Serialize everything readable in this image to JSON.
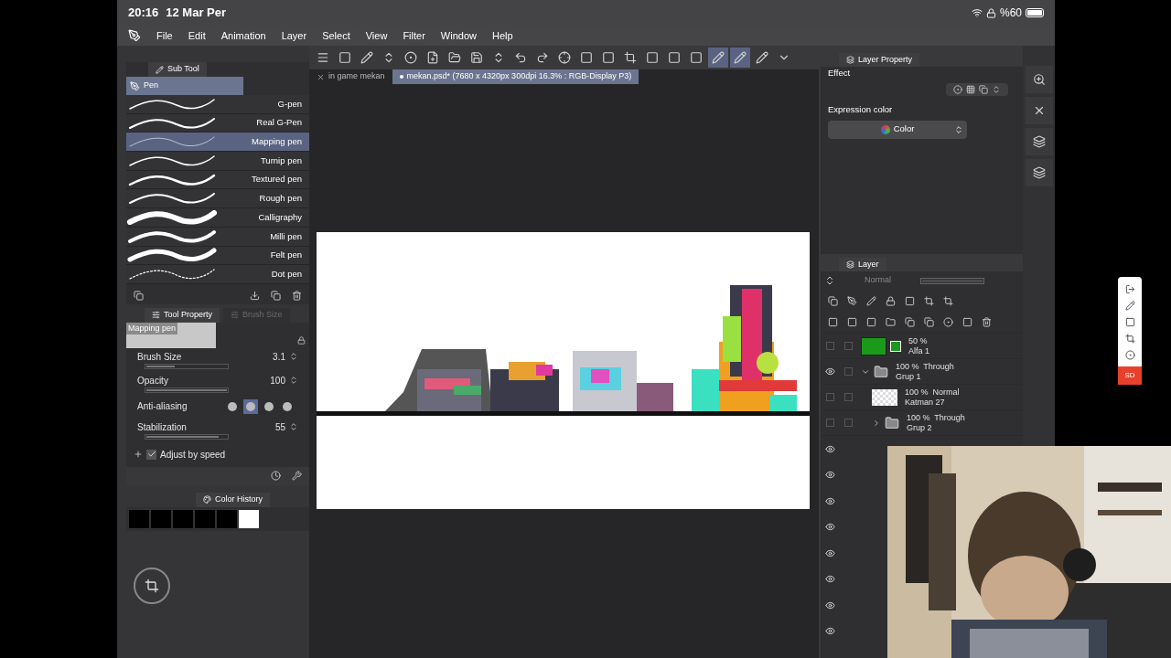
{
  "status_bar": {
    "time": "20:16",
    "date": "12 Mar Per",
    "battery": "%60"
  },
  "menu": [
    "File",
    "Edit",
    "Animation",
    "Layer",
    "Select",
    "View",
    "Filter",
    "Window",
    "Help"
  ],
  "doc_tabs": [
    {
      "label": "in game mekan",
      "selected": false
    },
    {
      "label": "mekan.psd* (7680 x 4320px 300dpi 16.3% : RGB-Display P3)",
      "selected": true
    }
  ],
  "sub_tool": {
    "title": "Sub Tool",
    "group": "Pen",
    "brushes": [
      {
        "name": "G-pen",
        "selected": false
      },
      {
        "name": "Real G-Pen",
        "selected": false
      },
      {
        "name": "Mapping pen",
        "selected": true
      },
      {
        "name": "Turnip pen",
        "selected": false
      },
      {
        "name": "Textured pen",
        "selected": false
      },
      {
        "name": "Rough pen",
        "selected": false
      },
      {
        "name": "Calligraphy",
        "selected": false
      },
      {
        "name": "Milli pen",
        "selected": false
      },
      {
        "name": "Felt pen",
        "selected": false
      },
      {
        "name": "Dot pen",
        "selected": false
      }
    ]
  },
  "tool_property": {
    "tabs": [
      {
        "label": "Tool Property",
        "selected": true
      },
      {
        "label": "Brush Size",
        "selected": false
      }
    ],
    "preview": "Mapping pen",
    "properties": [
      {
        "kind": "slider",
        "label": "Brush Size",
        "value": "3.1",
        "level": 0.35
      },
      {
        "kind": "slider",
        "label": "Opacity",
        "value": "100",
        "level": 1
      },
      {
        "kind": "choice",
        "label": "Anti-aliasing",
        "options": [
          {
            "selected": false
          },
          {
            "selected": true
          },
          {
            "selected": false
          },
          {
            "selected": false
          }
        ]
      },
      {
        "kind": "slider",
        "label": "Stabilization",
        "value": "55",
        "level": 0.9
      },
      {
        "kind": "checkbox",
        "label": "Adjust by speed",
        "checked": true
      }
    ]
  },
  "color_history": {
    "title": "Color History",
    "swatches": [
      {
        "color": "#000000"
      },
      {
        "color": "#000000"
      },
      {
        "color": "#000000"
      },
      {
        "color": "#000000"
      },
      {
        "color": "#000000"
      },
      {
        "color": "#ffffff"
      }
    ]
  },
  "layer_property": {
    "title": "Layer Property",
    "effect": "Effect",
    "expression_color": "Expression color",
    "color_mode": "Color"
  },
  "layer_panel": {
    "title": "Layer",
    "blend_mode": "Normal",
    "opacity_slider": {
      "level": 1
    },
    "layers": [
      {
        "kind": "layer",
        "info": "50 %",
        "name": "Alfa 1",
        "visible": false,
        "locked": false,
        "color": "#1a9a1a"
      },
      {
        "kind": "folder",
        "info": "100 %  Through",
        "name": "Grup 1",
        "visible": true,
        "locked": false,
        "expanded": true,
        "children": [
          {
            "kind": "layer",
            "info": "100 %  Normal",
            "name": "Katman 27",
            "visible": false,
            "locked": false
          },
          {
            "kind": "folder",
            "info": "100 %  Through",
            "name": "Grup 2",
            "visible": false,
            "locked": false,
            "expanded": false
          }
        ]
      }
    ],
    "covered_rows": [
      {
        "visible": true
      },
      {
        "visible": true
      },
      {
        "visible": true
      },
      {
        "visible": true
      },
      {
        "visible": true
      },
      {
        "visible": true
      },
      {
        "visible": true
      },
      {
        "visible": true
      }
    ]
  },
  "overlay_toolbar": {
    "badge": "SD"
  }
}
